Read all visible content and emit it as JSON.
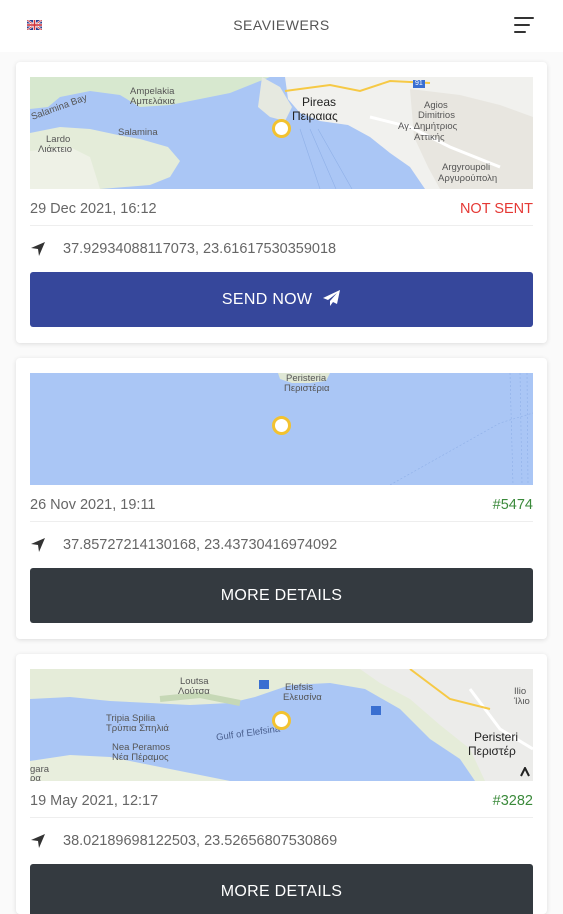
{
  "header": {
    "title": "SEAVIEWERS",
    "flag_icon": "uk-flag-icon",
    "menu_icon": "menu-icon"
  },
  "colors": {
    "accent_blue": "#36479b",
    "dark_button": "#343a40",
    "not_sent": "#e53935",
    "id_green": "#3b8a3b",
    "pin": "#f2c230",
    "sea": "#aac6f5"
  },
  "cards": [
    {
      "map_labels": [
        "Ampelakia",
        "Αμπελάκια",
        "Salamina",
        "Salamina Bay",
        "Lardo",
        "Λιάκτειο",
        "Pireas",
        "Πειραιας",
        "Agios",
        "Dimitrios",
        "Αγ. Δημήτριος",
        "Αττικής",
        "Argyroupoli",
        "Αργυρούπολη",
        "91"
      ],
      "date": "29 Dec 2021, 16:12",
      "status": "NOT SENT",
      "coordinates": "37.92934088117073, 23.61617530359018",
      "button_label": "SEND NOW"
    },
    {
      "map_labels": [
        "Peristeria",
        "Περιστέρια"
      ],
      "date": "26 Nov 2021, 19:11",
      "status": "#5474",
      "coordinates": "37.85727214130168, 23.43730416974092",
      "button_label": "MORE DETAILS"
    },
    {
      "map_labels": [
        "Loutsa",
        "Λούτσα",
        "Elefsis",
        "Ελευσίνα",
        "Gulf of Elefsina",
        "Tripia Spilia",
        "Τρύπια Σπηλιά",
        "Nea Peramos",
        "Νέα Πέραμος",
        "Peristeri",
        "Περιστέρ",
        "Ilio",
        "Ίλιο",
        "gara",
        "ρα"
      ],
      "date": "19 May 2021, 12:17",
      "status": "#3282",
      "coordinates": "38.02189698122503, 23.52656807530869",
      "button_label": "MORE DETAILS"
    }
  ]
}
